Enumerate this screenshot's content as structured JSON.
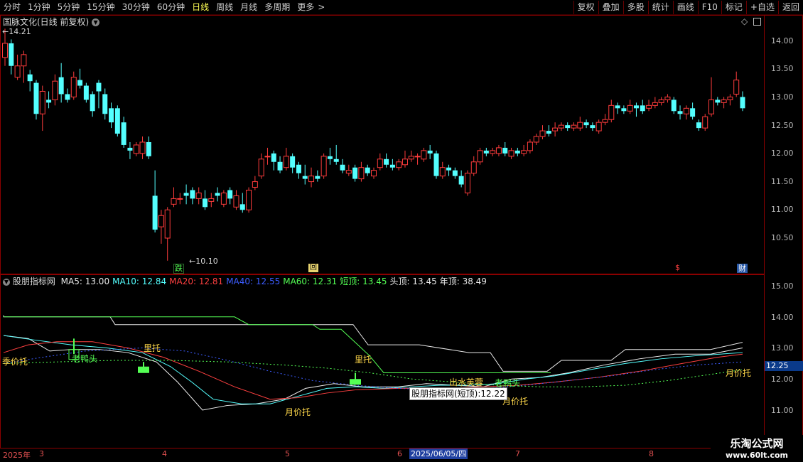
{
  "toolbar": {
    "tabs": [
      "分时",
      "1分钟",
      "5分钟",
      "15分钟",
      "30分钟",
      "60分钟",
      "日线",
      "周线",
      "月线",
      "多周期",
      "更多"
    ],
    "active_tab": "日线",
    "more_chevron": ">",
    "right_buttons": [
      "复权",
      "叠加",
      "多股",
      "统计",
      "画线",
      "F10",
      "标记",
      "+自选",
      "返回"
    ]
  },
  "main_chart": {
    "title": "国脉文化(日线 前复权)",
    "high_label": "14.21",
    "low_label": "10.10",
    "y_ticks": [
      "14.00",
      "13.50",
      "13.00",
      "12.50",
      "12.00",
      "11.50",
      "11.00",
      "10.50"
    ],
    "markers": {
      "die": "跌",
      "hui": "回",
      "dollar": "$",
      "cai": "财"
    }
  },
  "indicator": {
    "name": "股朋指标网",
    "legend": [
      {
        "label": "MA5: 13.00",
        "color": "#e8e8e8"
      },
      {
        "label": "MA10: 12.84",
        "color": "#54ffff"
      },
      {
        "label": "MA20: 12.81",
        "color": "#ff4040"
      },
      {
        "label": "MA40: 12.55",
        "color": "#3c5cff"
      },
      {
        "label": "MA60: 12.31",
        "color": "#54ff54"
      },
      {
        "label": "短顶: 13.45",
        "color": "#54ff54"
      },
      {
        "label": "头顶: 13.45",
        "color": "#e8e8e8"
      },
      {
        "label": "年顶: 38.49",
        "color": "#e8e8e8"
      }
    ],
    "y_ticks": [
      "15.00",
      "14.00",
      "13.00",
      "12.00",
      "11.00"
    ],
    "current_value": "12.25",
    "annotations": {
      "jijiatuo": "季价托",
      "laoyatou1": "老鸭头",
      "lituo1": "里托",
      "yuejiatuo_bottom": "月价托",
      "lituo2": "里托",
      "chushui": "出水芙蓉",
      "laoyatou2": "老鸭头",
      "yuejiatuo2": "月价托",
      "yuejiatuo3": "月价托"
    },
    "tooltip": "股朋指标网(短顶):12.22"
  },
  "x_axis": {
    "labels": [
      "2025年",
      "3",
      "4",
      "5",
      "6",
      "7",
      "8"
    ],
    "highlight_date": "2025/06/05/四"
  },
  "watermark": {
    "line1": "乐淘公式网",
    "line2": "www.60lt.com"
  },
  "chart_data": {
    "type": "candlestick",
    "symbol": "国脉文化",
    "period": "日线 前复权",
    "price_range": [
      10.1,
      14.21
    ],
    "summary": {
      "high": 14.21,
      "low": 10.1
    },
    "indicator_values": {
      "MA5": 13.0,
      "MA10": 12.84,
      "MA20": 12.81,
      "MA40": 12.55,
      "MA60": 12.31,
      "短顶": 13.45,
      "头顶": 13.45,
      "年顶": 38.49
    },
    "candles": [
      [
        13.7,
        13.95,
        14.21,
        13.55
      ],
      [
        13.95,
        13.55,
        14.02,
        13.4
      ],
      [
        13.35,
        13.55,
        13.75,
        13.3
      ],
      [
        13.55,
        13.75,
        13.82,
        13.25
      ],
      [
        13.4,
        13.28,
        13.48,
        13.1
      ],
      [
        13.25,
        12.7,
        13.3,
        12.6
      ],
      [
        12.7,
        13.1,
        13.2,
        12.4
      ],
      [
        12.95,
        12.9,
        13.1,
        12.8
      ],
      [
        12.95,
        13.28,
        13.4,
        12.85
      ],
      [
        13.35,
        13.05,
        13.6,
        12.9
      ],
      [
        13.05,
        12.95,
        13.15,
        12.9
      ],
      [
        13.0,
        13.35,
        13.45,
        12.95
      ],
      [
        13.3,
        13.2,
        13.5,
        13.15
      ],
      [
        13.2,
        12.95,
        13.25,
        12.9
      ],
      [
        13.05,
        12.75,
        13.1,
        12.65
      ],
      [
        13.25,
        13.1,
        13.3,
        12.8
      ],
      [
        13.05,
        12.7,
        13.15,
        12.6
      ],
      [
        12.8,
        12.55,
        12.9,
        12.45
      ],
      [
        12.8,
        12.35,
        12.85,
        12.3
      ],
      [
        12.55,
        12.15,
        12.65,
        12.1
      ],
      [
        12.1,
        12.05,
        12.2,
        11.9
      ],
      [
        12.0,
        12.15,
        12.2,
        11.95
      ],
      [
        12.0,
        12.2,
        12.3,
        11.9
      ],
      [
        12.2,
        11.95,
        12.3,
        11.9
      ],
      [
        11.25,
        10.65,
        11.7,
        10.6
      ],
      [
        10.7,
        10.9,
        11.0,
        10.4
      ],
      [
        10.5,
        11.0,
        11.05,
        10.1
      ],
      [
        11.1,
        11.2,
        11.4,
        11.05
      ],
      [
        11.2,
        11.2,
        11.3,
        11.1
      ],
      [
        11.3,
        11.25,
        11.45,
        11.1
      ],
      [
        11.35,
        11.2,
        11.4,
        11.1
      ],
      [
        11.2,
        11.3,
        11.4,
        11.1
      ],
      [
        11.2,
        11.05,
        11.35,
        11.0
      ],
      [
        11.15,
        11.2,
        11.3,
        11.05
      ],
      [
        11.3,
        11.25,
        11.4,
        11.15
      ],
      [
        11.1,
        11.3,
        11.35,
        11.05
      ],
      [
        11.35,
        11.2,
        11.4,
        11.1
      ],
      [
        11.05,
        11.25,
        11.35,
        11.0
      ],
      [
        11.1,
        11.0,
        11.3,
        10.95
      ],
      [
        11.0,
        11.35,
        11.4,
        10.95
      ],
      [
        11.4,
        11.5,
        11.6,
        11.35
      ],
      [
        11.6,
        11.9,
        12.0,
        11.55
      ],
      [
        11.95,
        11.95,
        12.1,
        11.8
      ],
      [
        12.0,
        11.85,
        12.05,
        11.7
      ],
      [
        11.85,
        11.7,
        11.95,
        11.65
      ],
      [
        11.75,
        11.95,
        12.1,
        11.7
      ],
      [
        11.95,
        11.75,
        12.0,
        11.65
      ],
      [
        11.8,
        11.65,
        11.85,
        11.55
      ],
      [
        11.6,
        11.55,
        11.8,
        11.45
      ],
      [
        11.5,
        11.6,
        11.75,
        11.4
      ],
      [
        11.6,
        11.55,
        11.7,
        11.5
      ],
      [
        11.6,
        11.95,
        12.0,
        11.55
      ],
      [
        11.95,
        11.9,
        12.1,
        11.8
      ],
      [
        11.9,
        11.85,
        12.15,
        11.8
      ],
      [
        11.8,
        11.7,
        11.9,
        11.65
      ],
      [
        11.65,
        11.7,
        11.8,
        11.6
      ],
      [
        11.75,
        11.55,
        11.8,
        11.5
      ],
      [
        11.55,
        11.75,
        11.85,
        11.5
      ],
      [
        11.75,
        11.65,
        11.8,
        11.6
      ],
      [
        11.6,
        11.7,
        11.75,
        11.55
      ],
      [
        11.75,
        11.9,
        12.0,
        11.7
      ],
      [
        11.9,
        11.8,
        12.0,
        11.75
      ],
      [
        11.8,
        11.75,
        11.9,
        11.7
      ],
      [
        11.75,
        11.85,
        11.9,
        11.7
      ],
      [
        11.8,
        11.9,
        12.05,
        11.75
      ],
      [
        11.9,
        11.95,
        12.05,
        11.85
      ],
      [
        11.95,
        11.95,
        12.0,
        11.8
      ],
      [
        11.9,
        12.05,
        12.1,
        11.85
      ],
      [
        12.05,
        12.0,
        12.15,
        11.9
      ],
      [
        12.0,
        11.6,
        12.05,
        11.55
      ],
      [
        11.6,
        11.75,
        11.85,
        11.55
      ],
      [
        11.75,
        11.7,
        11.8,
        11.6
      ],
      [
        11.7,
        11.6,
        11.75,
        11.55
      ],
      [
        11.6,
        11.45,
        11.7,
        11.4
      ],
      [
        11.3,
        11.65,
        11.7,
        11.25
      ],
      [
        11.65,
        11.85,
        11.95,
        11.6
      ],
      [
        11.85,
        12.05,
        12.1,
        11.8
      ],
      [
        12.05,
        12.0,
        12.1,
        11.95
      ],
      [
        12.0,
        12.05,
        12.1,
        11.95
      ],
      [
        12.0,
        12.1,
        12.15,
        11.95
      ],
      [
        12.1,
        12.0,
        12.2,
        11.95
      ],
      [
        11.95,
        12.05,
        12.1,
        11.9
      ],
      [
        12.05,
        12.0,
        12.1,
        11.95
      ],
      [
        12.0,
        12.05,
        12.15,
        11.95
      ],
      [
        12.05,
        12.2,
        12.25,
        12.0
      ],
      [
        12.2,
        12.3,
        12.35,
        12.15
      ],
      [
        12.3,
        12.4,
        12.5,
        12.25
      ],
      [
        12.4,
        12.35,
        12.5,
        12.3
      ],
      [
        12.4,
        12.45,
        12.55,
        12.3
      ],
      [
        12.45,
        12.5,
        12.55,
        12.4
      ],
      [
        12.5,
        12.45,
        12.55,
        12.4
      ],
      [
        12.45,
        12.5,
        12.55,
        12.4
      ],
      [
        12.45,
        12.55,
        12.65,
        12.4
      ],
      [
        12.55,
        12.5,
        12.6,
        12.45
      ],
      [
        12.5,
        12.45,
        12.55,
        12.4
      ],
      [
        12.4,
        12.55,
        12.6,
        12.35
      ],
      [
        12.55,
        12.6,
        12.7,
        12.5
      ],
      [
        12.6,
        12.85,
        12.95,
        12.55
      ],
      [
        12.85,
        12.8,
        12.9,
        12.7
      ],
      [
        12.8,
        12.75,
        12.85,
        12.7
      ],
      [
        12.75,
        12.85,
        12.95,
        12.7
      ],
      [
        12.85,
        12.8,
        12.9,
        12.65
      ],
      [
        12.85,
        12.75,
        12.95,
        12.7
      ],
      [
        12.8,
        12.85,
        12.95,
        12.75
      ],
      [
        12.85,
        12.9,
        13.0,
        12.8
      ],
      [
        12.9,
        12.95,
        13.0,
        12.85
      ],
      [
        12.95,
        13.0,
        13.05,
        12.9
      ],
      [
        12.95,
        12.75,
        13.0,
        12.7
      ],
      [
        12.75,
        12.7,
        12.85,
        12.6
      ],
      [
        12.7,
        12.8,
        12.85,
        12.6
      ],
      [
        12.8,
        12.65,
        12.9,
        12.6
      ],
      [
        12.55,
        12.45,
        12.6,
        12.4
      ],
      [
        12.45,
        12.65,
        12.7,
        12.4
      ],
      [
        12.7,
        12.95,
        13.35,
        12.65
      ],
      [
        12.95,
        12.9,
        13.0,
        12.85
      ],
      [
        12.9,
        12.95,
        13.0,
        12.8
      ],
      [
        12.95,
        13.0,
        13.05,
        12.85
      ],
      [
        13.05,
        13.3,
        13.45,
        13.0
      ],
      [
        13.0,
        12.8,
        13.1,
        12.75
      ]
    ]
  }
}
